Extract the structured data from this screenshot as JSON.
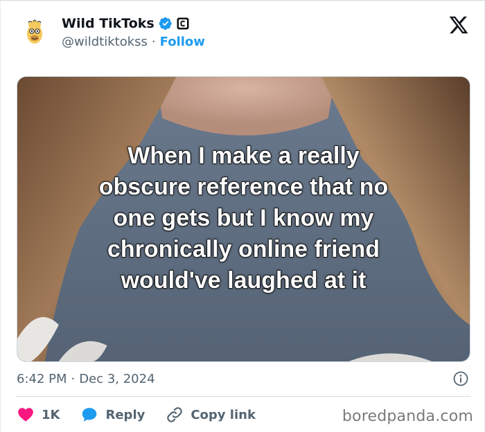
{
  "author": {
    "display_name": "Wild TikToks",
    "handle": "@wildtiktokss",
    "separator": "·",
    "follow_label": "Follow"
  },
  "media": {
    "caption_lines": [
      "When I make a really",
      "obscure reference that no",
      "one gets but I know my",
      "chronically online friend",
      "would've laughed at it"
    ]
  },
  "meta": {
    "time": "6:42 PM",
    "separator": "·",
    "date": "Dec 3, 2024"
  },
  "actions": {
    "like_count": "1K",
    "reply_label": "Reply",
    "copy_link_label": "Copy link"
  },
  "watermark": "boredpanda.com",
  "colors": {
    "accent": "#1d9bf0",
    "like": "#f91880",
    "text_secondary": "#536471"
  }
}
